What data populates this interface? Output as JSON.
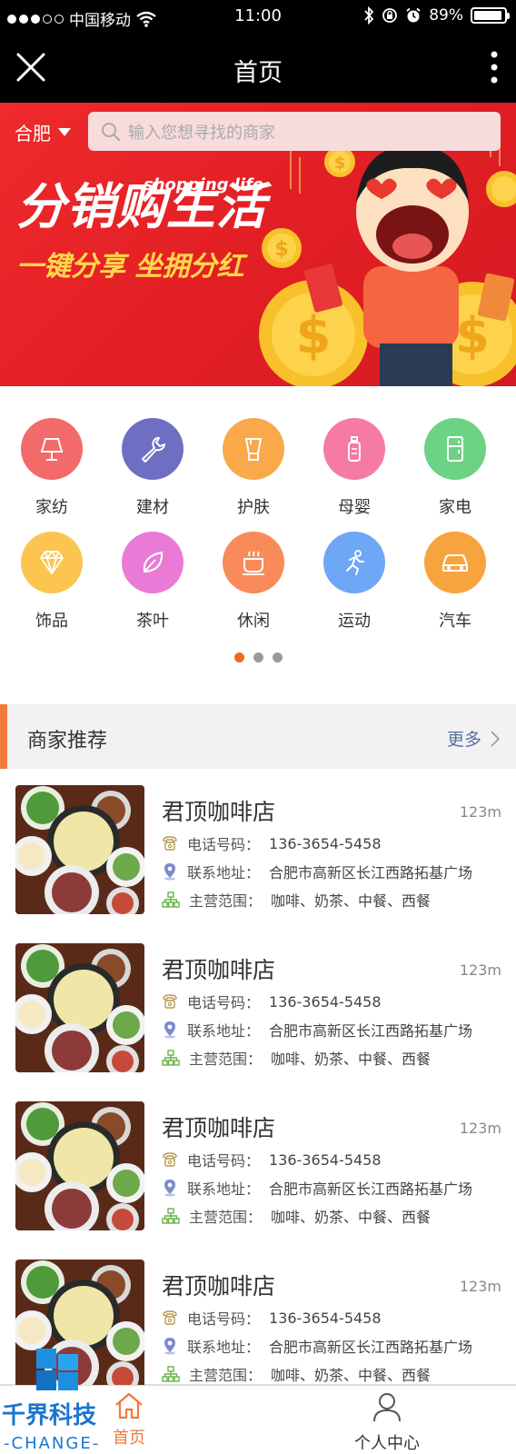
{
  "status_bar": {
    "carrier": "中国移动",
    "time": "11:00",
    "battery": "89%"
  },
  "nav": {
    "title": "首页"
  },
  "banner": {
    "city": "合肥",
    "search_placeholder": "输入您想寻找的商家",
    "promo_title": "分销购生活",
    "promo_en": "shopping life",
    "promo_sub": "一键分享 坐拥分红"
  },
  "categories": [
    {
      "label": "家纺",
      "icon": "lamp-icon",
      "color": "#f26a6a"
    },
    {
      "label": "建材",
      "icon": "wrench-icon",
      "color": "#6e6fc2"
    },
    {
      "label": "护肤",
      "icon": "cosmetic-icon",
      "color": "#f9a84a"
    },
    {
      "label": "母婴",
      "icon": "baby-bottle-icon",
      "color": "#f57aa6"
    },
    {
      "label": "家电",
      "icon": "fridge-icon",
      "color": "#6dd283"
    },
    {
      "label": "饰品",
      "icon": "diamond-icon",
      "color": "#fbc550"
    },
    {
      "label": "茶叶",
      "icon": "leaf-icon",
      "color": "#e97ad6"
    },
    {
      "label": "休闲",
      "icon": "tea-cup-icon",
      "color": "#f98b5a"
    },
    {
      "label": "运动",
      "icon": "runner-icon",
      "color": "#6ea7f5"
    },
    {
      "label": "汽车",
      "icon": "car-icon",
      "color": "#f7a43e"
    }
  ],
  "section": {
    "title": "商家推荐",
    "more": "更多"
  },
  "shops": [
    {
      "name": "君顶咖啡店",
      "distance": "123m",
      "phone_label": "电话号码：",
      "phone": "136-3654-5458",
      "address_label": "联系地址：",
      "address": "合肥市高新区长江西路拓基广场",
      "scope_label": "主营范围：",
      "scope": "咖啡、奶茶、中餐、西餐"
    },
    {
      "name": "君顶咖啡店",
      "distance": "123m",
      "phone_label": "电话号码：",
      "phone": "136-3654-5458",
      "address_label": "联系地址：",
      "address": "合肥市高新区长江西路拓基广场",
      "scope_label": "主营范围：",
      "scope": "咖啡、奶茶、中餐、西餐"
    },
    {
      "name": "君顶咖啡店",
      "distance": "123m",
      "phone_label": "电话号码：",
      "phone": "136-3654-5458",
      "address_label": "联系地址：",
      "address": "合肥市高新区长江西路拓基广场",
      "scope_label": "主营范围：",
      "scope": "咖啡、奶茶、中餐、西餐"
    },
    {
      "name": "君顶咖啡店",
      "distance": "123m",
      "phone_label": "电话号码：",
      "phone": "136-3654-5458",
      "address_label": "联系地址：",
      "address": "合肥市高新区长江西路拓基广场",
      "scope_label": "主营范围：",
      "scope": "咖啡、奶茶、中餐、西餐"
    }
  ],
  "tabs": {
    "home": "首页",
    "profile": "个人中心"
  },
  "watermark": {
    "name": "千界科技",
    "en": "CHANGE"
  },
  "colors": {
    "accent": "#f07a3a",
    "banner_red": "#e21f24",
    "link": "#5b6fa8"
  }
}
